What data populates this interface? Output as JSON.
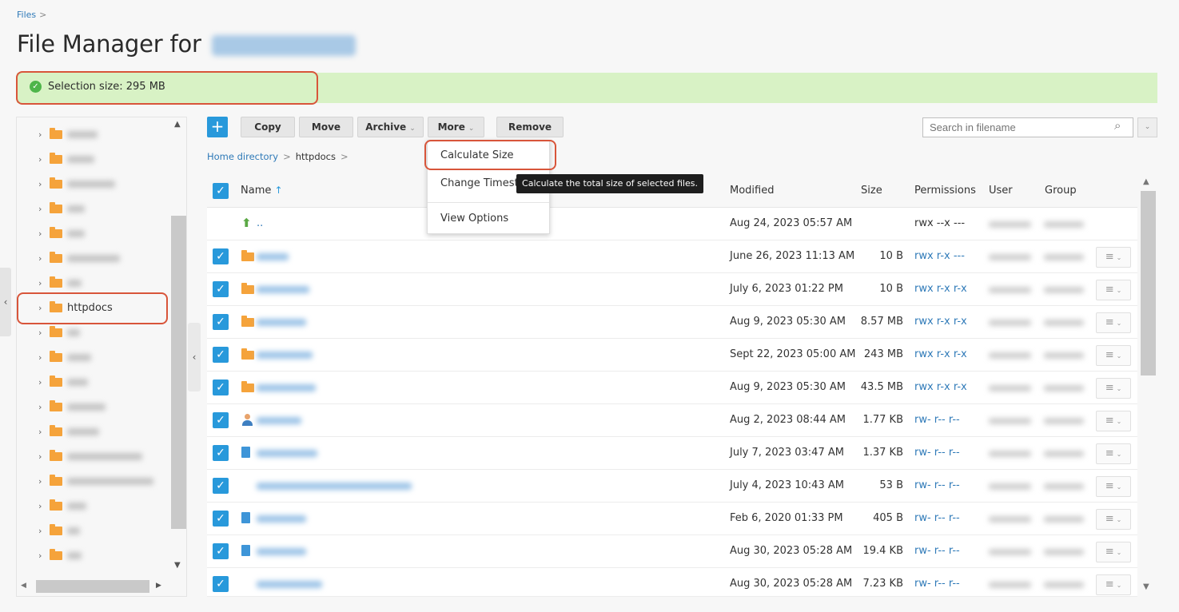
{
  "breadcrumb": {
    "root": "Files",
    "sep": ">"
  },
  "page": {
    "title": "File Manager for"
  },
  "banner": {
    "text": "Selection size: 295 MB",
    "color": "#d8f2c5"
  },
  "toolbar": {
    "add_label": "+",
    "copy": "Copy",
    "move": "Move",
    "archive": "Archive",
    "more": "More",
    "remove": "Remove",
    "caret": "⌄"
  },
  "search": {
    "placeholder": "Search in filename"
  },
  "path": {
    "home": "Home directory",
    "current": "httpdocs",
    "sep": ">"
  },
  "tree": {
    "selected": "httpdocs"
  },
  "table": {
    "headers": {
      "name": "Name",
      "sort": "↑",
      "modified": "Modified",
      "size": "Size",
      "permissions": "Permissions",
      "user": "User",
      "group": "Group"
    },
    "parent": {
      "name": "..",
      "modified": "Aug 24, 2023 05:57 AM",
      "permissions": "rwx --x ---"
    },
    "rows": [
      {
        "modified": "June 26, 2023 11:13 AM",
        "size": "10 B",
        "permissions": "rwx r-x ---"
      },
      {
        "modified": "July 6, 2023 01:22 PM",
        "size": "10 B",
        "permissions": "rwx r-x r-x"
      },
      {
        "modified": "Aug 9, 2023 05:30 AM",
        "size": "8.57 MB",
        "permissions": "rwx r-x r-x"
      },
      {
        "modified": "Sept 22, 2023 05:00 AM",
        "size": "243 MB",
        "permissions": "rwx r-x r-x"
      },
      {
        "modified": "Aug 9, 2023 05:30 AM",
        "size": "43.5 MB",
        "permissions": "rwx r-x r-x"
      },
      {
        "modified": "Aug 2, 2023 08:44 AM",
        "size": "1.77 KB",
        "permissions": "rw- r-- r--"
      },
      {
        "modified": "July 7, 2023 03:47 AM",
        "size": "1.37 KB",
        "permissions": "rw- r-- r--"
      },
      {
        "modified": "July 4, 2023 10:43 AM",
        "size": "53 B",
        "permissions": "rw- r-- r--"
      },
      {
        "modified": "Feb 6, 2020 01:33 PM",
        "size": "405 B",
        "permissions": "rw- r-- r--"
      },
      {
        "modified": "Aug 30, 2023 05:28 AM",
        "size": "19.4 KB",
        "permissions": "rw- r-- r--"
      },
      {
        "modified": "Aug 30, 2023 05:28 AM",
        "size": "7.23 KB",
        "permissions": "rw- r-- r--"
      }
    ]
  },
  "dropdown": {
    "calculate": "Calculate Size",
    "timestamp": "Change Timest",
    "view": "View Options"
  },
  "tooltip": {
    "text": "Calculate the total size of selected files."
  },
  "colors": {
    "accent": "#2899db",
    "highlight": "#d8553a",
    "folder": "#f5a33b"
  }
}
